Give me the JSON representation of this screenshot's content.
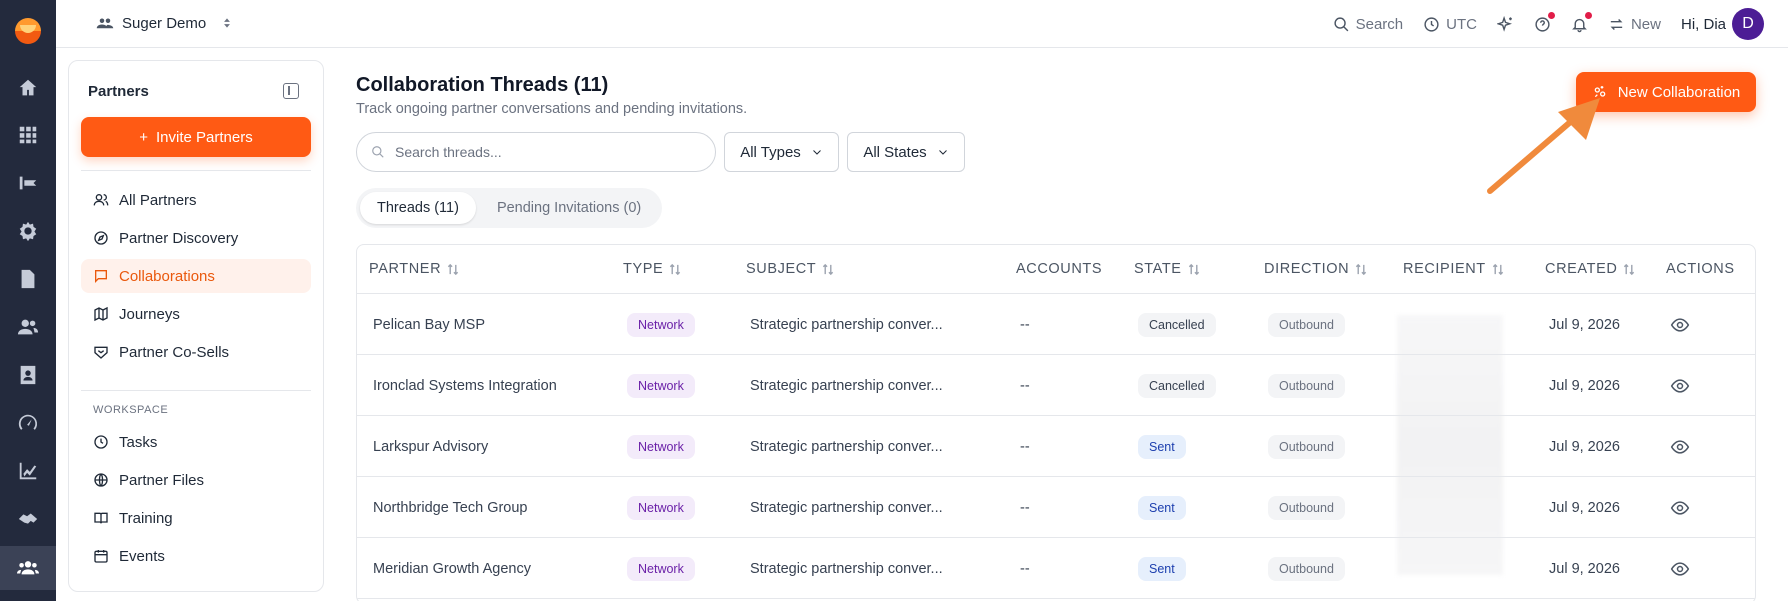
{
  "rail": {
    "items": [
      "home-icon",
      "apps-grid-icon",
      "analytics-icon",
      "settings-icon",
      "document-icon",
      "users-icon",
      "contacts-icon",
      "gauge-icon",
      "chart-icon",
      "handshake-icon",
      "partners-icon"
    ],
    "active": "partners-icon"
  },
  "topbar": {
    "org_name": "Suger Demo",
    "search_label": "Search",
    "timezone": "UTC",
    "new_label": "New",
    "greeting": "Hi, Dia",
    "avatar_initial": "D"
  },
  "sidebar": {
    "title": "Partners",
    "invite_button": "Invite Partners",
    "items": [
      {
        "label": "All Partners",
        "icon": "users-icon"
      },
      {
        "label": "Partner Discovery",
        "icon": "compass-icon"
      },
      {
        "label": "Collaborations",
        "icon": "chat-icon",
        "active": true
      },
      {
        "label": "Journeys",
        "icon": "map-icon"
      },
      {
        "label": "Partner Co-Sells",
        "icon": "handshake-icon"
      }
    ],
    "workspace_label": "WORKSPACE",
    "workspace_items": [
      {
        "label": "Tasks",
        "icon": "clock-icon"
      },
      {
        "label": "Partner Files",
        "icon": "globe-icon"
      },
      {
        "label": "Training",
        "icon": "book-icon"
      },
      {
        "label": "Events",
        "icon": "calendar-icon"
      }
    ]
  },
  "main": {
    "title": "Collaboration Threads (11)",
    "subtitle": "Track ongoing partner conversations and pending invitations.",
    "new_button": "New Collaboration",
    "search_placeholder": "Search threads...",
    "filter_type": "All Types",
    "filter_state": "All States",
    "tabs": [
      {
        "label": "Threads (11)",
        "active": true
      },
      {
        "label": "Pending Invitations (0)",
        "active": false
      }
    ]
  },
  "table": {
    "columns": [
      "PARTNER",
      "TYPE",
      "SUBJECT",
      "ACCOUNTS",
      "STATE",
      "DIRECTION",
      "RECIPIENT",
      "CREATED",
      "ACTIONS"
    ],
    "rows": [
      {
        "partner": "Pelican Bay MSP",
        "type": "Network",
        "subject": "Strategic partnership conver...",
        "accounts": "--",
        "state": "Cancelled",
        "direction": "Outbound",
        "created": "Jul 9, 2026"
      },
      {
        "partner": "Ironclad Systems Integration",
        "type": "Network",
        "subject": "Strategic partnership conver...",
        "accounts": "--",
        "state": "Cancelled",
        "direction": "Outbound",
        "created": "Jul 9, 2026"
      },
      {
        "partner": "Larkspur Advisory",
        "type": "Network",
        "subject": "Strategic partnership conver...",
        "accounts": "--",
        "state": "Sent",
        "direction": "Outbound",
        "created": "Jul 9, 2026"
      },
      {
        "partner": "Northbridge Tech Group",
        "type": "Network",
        "subject": "Strategic partnership conver...",
        "accounts": "--",
        "state": "Sent",
        "direction": "Outbound",
        "created": "Jul 9, 2026"
      },
      {
        "partner": "Meridian Growth Agency",
        "type": "Network",
        "subject": "Strategic partnership conver...",
        "accounts": "--",
        "state": "Sent",
        "direction": "Outbound",
        "created": "Jul 9, 2026"
      }
    ]
  },
  "colors": {
    "accent": "#ff5a14",
    "rail": "#232a3d"
  }
}
